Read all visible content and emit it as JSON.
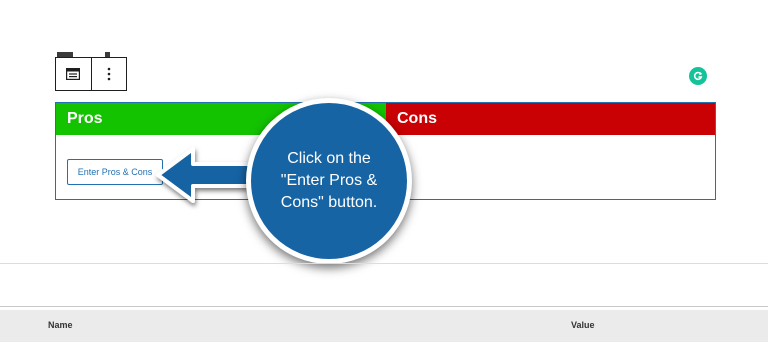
{
  "table_block": {
    "pros_label": "Pros",
    "cons_label": "Cons",
    "enter_button_label": "Enter Pros & Cons"
  },
  "callout": {
    "text": "Click on the \"Enter Pros & Cons\" button."
  },
  "meta_table": {
    "columns": [
      "Name",
      "Value"
    ]
  },
  "colors": {
    "pros": "#13c300",
    "cons": "#c90004",
    "callout": "#1664a4",
    "accent": "#2271b1"
  },
  "icons": [
    "block-table-icon",
    "more-options-icon",
    "grammarly-icon",
    "arrow-left-icon"
  ]
}
